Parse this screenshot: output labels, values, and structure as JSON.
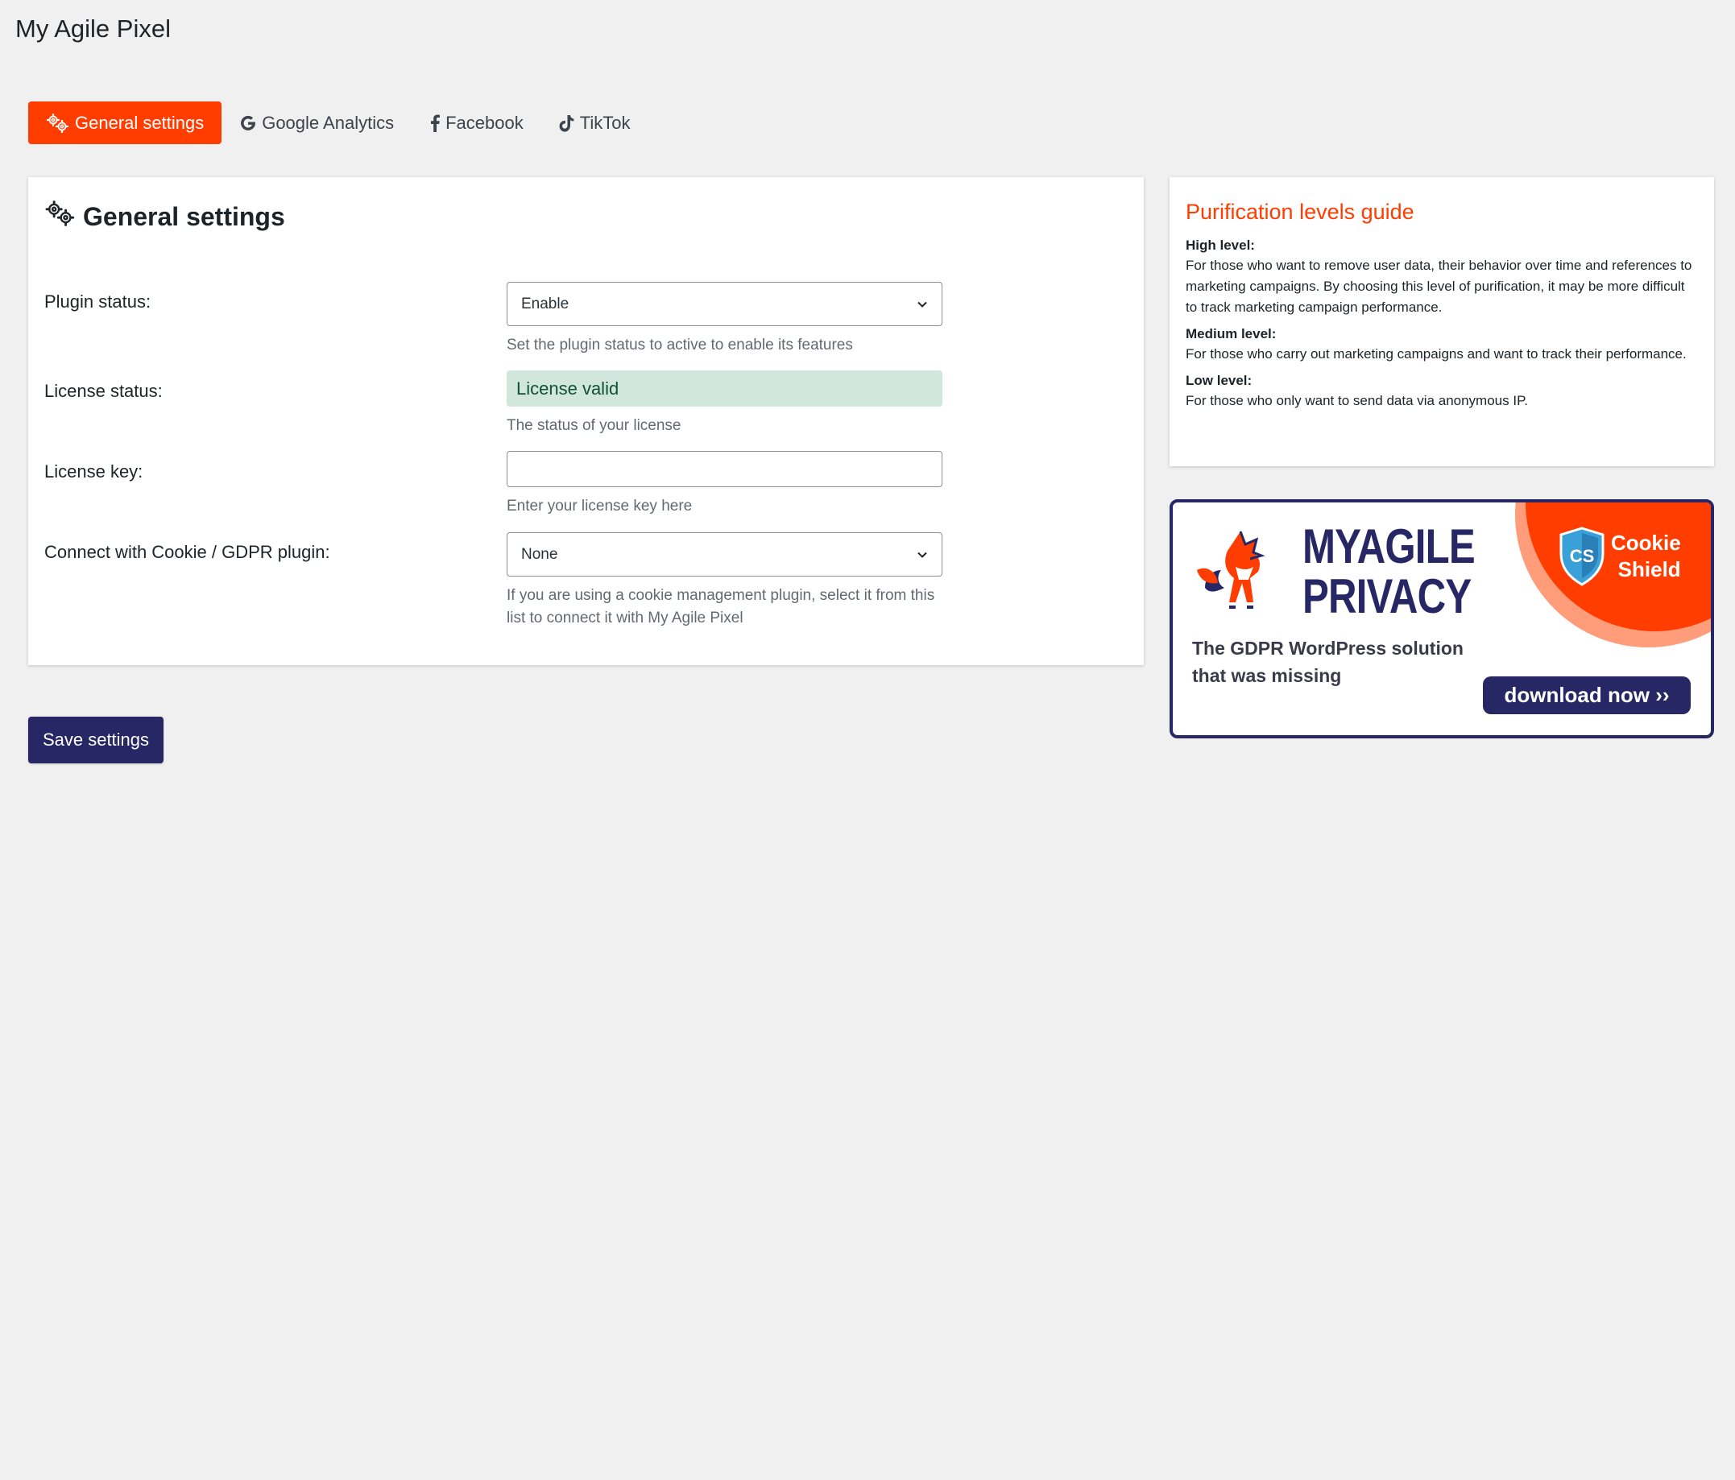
{
  "page": {
    "title": "My Agile Pixel"
  },
  "tabs": [
    {
      "label": "General settings",
      "icon": "gears-icon",
      "active": true
    },
    {
      "label": "Google Analytics",
      "icon": "google-icon",
      "active": false
    },
    {
      "label": "Facebook",
      "icon": "facebook-icon",
      "active": false
    },
    {
      "label": "TikTok",
      "icon": "tiktok-icon",
      "active": false
    }
  ],
  "general": {
    "heading": "General settings",
    "plugin_status": {
      "label": "Plugin status:",
      "value": "Enable",
      "help": "Set the plugin status to active to enable its features"
    },
    "license_status": {
      "label": "License status:",
      "value": "License valid",
      "help": "The status of your license"
    },
    "license_key": {
      "label": "License key:",
      "value": "",
      "help": "Enter your license key here"
    },
    "cookie_plugin": {
      "label": "Connect with Cookie / GDPR plugin:",
      "value": "None",
      "help": "If you are using a cookie management plugin, select it from this list to connect it with My Agile Pixel"
    }
  },
  "save_label": "Save settings",
  "guide": {
    "title": "Purification levels guide",
    "levels": [
      {
        "name": "High level:",
        "text": "For those who want to remove user data, their behavior over time and references to marketing campaigns. By choosing this level of purification, it may be more difficult to track marketing campaign performance."
      },
      {
        "name": "Medium level:",
        "text": "For those who carry out marketing campaigns and want to track their performance."
      },
      {
        "name": "Low level:",
        "text": "For those who only want to send data via anonymous IP."
      }
    ]
  },
  "banner": {
    "brand_line1": "MYAGILE",
    "brand_line2": "PRIVACY",
    "tagline": "The GDPR WordPress solution that was missing",
    "badge_line1": "Cookie",
    "badge_line2": "Shield",
    "shield_letters": "CS",
    "cta": "download now ››"
  },
  "colors": {
    "accent": "#ff3d00",
    "primary": "#262764",
    "success_bg": "#d1e7dd",
    "success_text": "#0f5132",
    "background": "#f0f0f1"
  }
}
